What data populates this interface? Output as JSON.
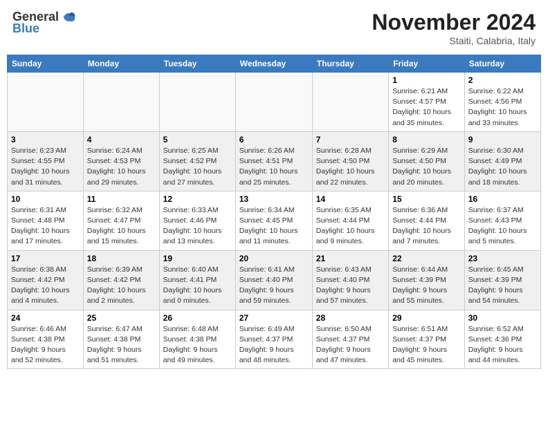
{
  "header": {
    "logo_general": "General",
    "logo_blue": "Blue",
    "month_title": "November 2024",
    "location": "Staiti, Calabria, Italy"
  },
  "weekdays": [
    "Sunday",
    "Monday",
    "Tuesday",
    "Wednesday",
    "Thursday",
    "Friday",
    "Saturday"
  ],
  "weeks": [
    {
      "shaded": false,
      "days": [
        {
          "num": "",
          "info": ""
        },
        {
          "num": "",
          "info": ""
        },
        {
          "num": "",
          "info": ""
        },
        {
          "num": "",
          "info": ""
        },
        {
          "num": "",
          "info": ""
        },
        {
          "num": "1",
          "info": "Sunrise: 6:21 AM\nSunset: 4:57 PM\nDaylight: 10 hours\nand 35 minutes."
        },
        {
          "num": "2",
          "info": "Sunrise: 6:22 AM\nSunset: 4:56 PM\nDaylight: 10 hours\nand 33 minutes."
        }
      ]
    },
    {
      "shaded": true,
      "days": [
        {
          "num": "3",
          "info": "Sunrise: 6:23 AM\nSunset: 4:55 PM\nDaylight: 10 hours\nand 31 minutes."
        },
        {
          "num": "4",
          "info": "Sunrise: 6:24 AM\nSunset: 4:53 PM\nDaylight: 10 hours\nand 29 minutes."
        },
        {
          "num": "5",
          "info": "Sunrise: 6:25 AM\nSunset: 4:52 PM\nDaylight: 10 hours\nand 27 minutes."
        },
        {
          "num": "6",
          "info": "Sunrise: 6:26 AM\nSunset: 4:51 PM\nDaylight: 10 hours\nand 25 minutes."
        },
        {
          "num": "7",
          "info": "Sunrise: 6:28 AM\nSunset: 4:50 PM\nDaylight: 10 hours\nand 22 minutes."
        },
        {
          "num": "8",
          "info": "Sunrise: 6:29 AM\nSunset: 4:50 PM\nDaylight: 10 hours\nand 20 minutes."
        },
        {
          "num": "9",
          "info": "Sunrise: 6:30 AM\nSunset: 4:49 PM\nDaylight: 10 hours\nand 18 minutes."
        }
      ]
    },
    {
      "shaded": false,
      "days": [
        {
          "num": "10",
          "info": "Sunrise: 6:31 AM\nSunset: 4:48 PM\nDaylight: 10 hours\nand 17 minutes."
        },
        {
          "num": "11",
          "info": "Sunrise: 6:32 AM\nSunset: 4:47 PM\nDaylight: 10 hours\nand 15 minutes."
        },
        {
          "num": "12",
          "info": "Sunrise: 6:33 AM\nSunset: 4:46 PM\nDaylight: 10 hours\nand 13 minutes."
        },
        {
          "num": "13",
          "info": "Sunrise: 6:34 AM\nSunset: 4:45 PM\nDaylight: 10 hours\nand 11 minutes."
        },
        {
          "num": "14",
          "info": "Sunrise: 6:35 AM\nSunset: 4:44 PM\nDaylight: 10 hours\nand 9 minutes."
        },
        {
          "num": "15",
          "info": "Sunrise: 6:36 AM\nSunset: 4:44 PM\nDaylight: 10 hours\nand 7 minutes."
        },
        {
          "num": "16",
          "info": "Sunrise: 6:37 AM\nSunset: 4:43 PM\nDaylight: 10 hours\nand 5 minutes."
        }
      ]
    },
    {
      "shaded": true,
      "days": [
        {
          "num": "17",
          "info": "Sunrise: 6:38 AM\nSunset: 4:42 PM\nDaylight: 10 hours\nand 4 minutes."
        },
        {
          "num": "18",
          "info": "Sunrise: 6:39 AM\nSunset: 4:42 PM\nDaylight: 10 hours\nand 2 minutes."
        },
        {
          "num": "19",
          "info": "Sunrise: 6:40 AM\nSunset: 4:41 PM\nDaylight: 10 hours\nand 0 minutes."
        },
        {
          "num": "20",
          "info": "Sunrise: 6:41 AM\nSunset: 4:40 PM\nDaylight: 9 hours\nand 59 minutes."
        },
        {
          "num": "21",
          "info": "Sunrise: 6:43 AM\nSunset: 4:40 PM\nDaylight: 9 hours\nand 57 minutes."
        },
        {
          "num": "22",
          "info": "Sunrise: 6:44 AM\nSunset: 4:39 PM\nDaylight: 9 hours\nand 55 minutes."
        },
        {
          "num": "23",
          "info": "Sunrise: 6:45 AM\nSunset: 4:39 PM\nDaylight: 9 hours\nand 54 minutes."
        }
      ]
    },
    {
      "shaded": false,
      "days": [
        {
          "num": "24",
          "info": "Sunrise: 6:46 AM\nSunset: 4:38 PM\nDaylight: 9 hours\nand 52 minutes."
        },
        {
          "num": "25",
          "info": "Sunrise: 6:47 AM\nSunset: 4:38 PM\nDaylight: 9 hours\nand 51 minutes."
        },
        {
          "num": "26",
          "info": "Sunrise: 6:48 AM\nSunset: 4:38 PM\nDaylight: 9 hours\nand 49 minutes."
        },
        {
          "num": "27",
          "info": "Sunrise: 6:49 AM\nSunset: 4:37 PM\nDaylight: 9 hours\nand 48 minutes."
        },
        {
          "num": "28",
          "info": "Sunrise: 6:50 AM\nSunset: 4:37 PM\nDaylight: 9 hours\nand 47 minutes."
        },
        {
          "num": "29",
          "info": "Sunrise: 6:51 AM\nSunset: 4:37 PM\nDaylight: 9 hours\nand 45 minutes."
        },
        {
          "num": "30",
          "info": "Sunrise: 6:52 AM\nSunset: 4:36 PM\nDaylight: 9 hours\nand 44 minutes."
        }
      ]
    }
  ]
}
